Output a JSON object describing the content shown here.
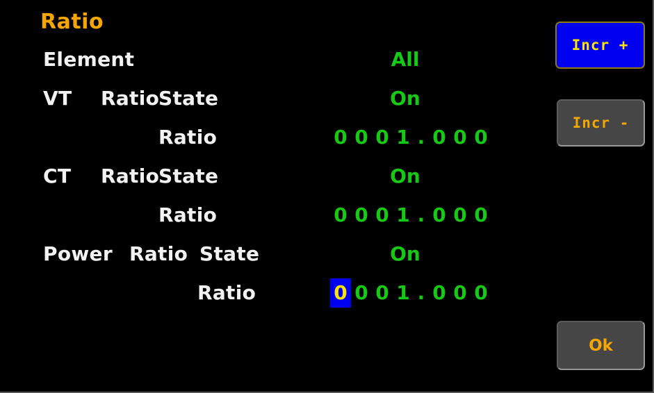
{
  "screen": {
    "title": "Ratio",
    "background_color": "#000000",
    "accent_color": "#f5a600",
    "value_color": "#16c916",
    "label_color": "#f2f2f2",
    "highlight_bg_color": "#0000f0",
    "highlight_fg_color": "#ffe400"
  },
  "rows": {
    "element": {
      "label": "Element",
      "value": "All"
    },
    "vt_ratio_state": {
      "label_1": "VT",
      "label_2": "Ratio",
      "label_3": "State",
      "value": "On"
    },
    "vt_ratio": {
      "label": "Ratio",
      "value": "0001.000",
      "digits": [
        "0",
        "0",
        "0",
        "1",
        ".",
        "0",
        "0",
        "0"
      ],
      "selected_index": -1
    },
    "ct_ratio_state": {
      "label_1": "CT",
      "label_2": "Ratio",
      "label_3": "State",
      "value": "On"
    },
    "ct_ratio": {
      "label": "Ratio",
      "value": "0001.000",
      "digits": [
        "0",
        "0",
        "0",
        "1",
        ".",
        "0",
        "0",
        "0"
      ],
      "selected_index": -1
    },
    "power_ratio_state": {
      "label_1": "Power",
      "label_2": "Ratio",
      "label_3": "State",
      "value": "On"
    },
    "power_ratio": {
      "label": "Ratio",
      "value": "0001.000",
      "digits": [
        "0",
        "0",
        "0",
        "1",
        ".",
        "0",
        "0",
        "0"
      ],
      "selected_index": 0
    }
  },
  "buttons": {
    "incr_plus": {
      "label": "Incr +",
      "state": "active"
    },
    "incr_minus": {
      "label": "Incr -",
      "state": "normal"
    },
    "ok": {
      "label": "Ok",
      "state": "normal"
    }
  }
}
